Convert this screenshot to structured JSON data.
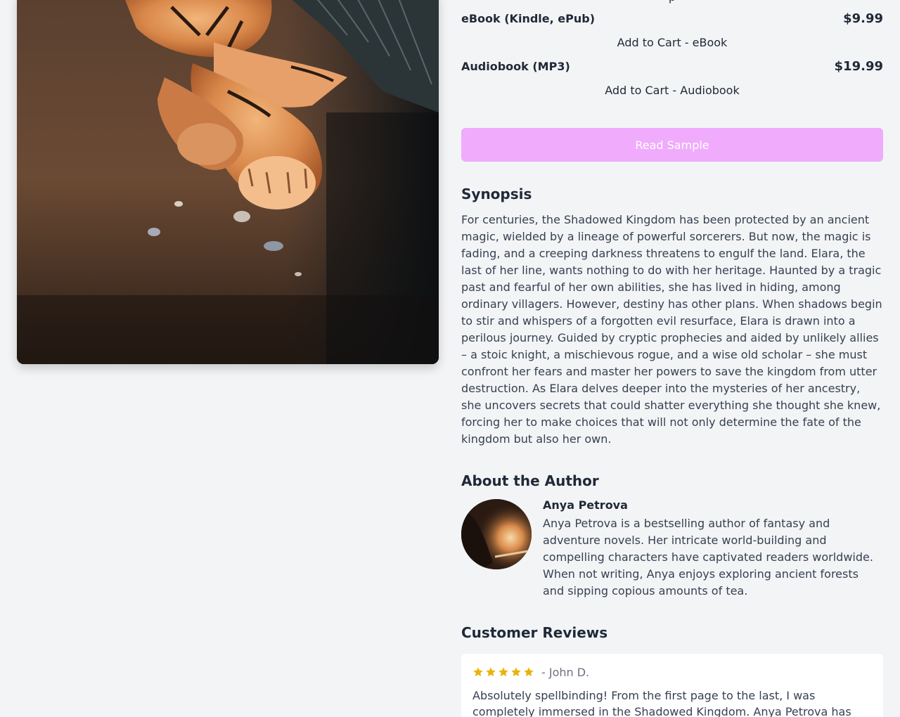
{
  "formats": [
    {
      "name": "eBook (Kindle, ePub)",
      "price": "$9.99",
      "cart_label": "Add to Cart - eBook"
    },
    {
      "name": "Audiobook (MP3)",
      "price": "$19.99",
      "cart_label": "Add to Cart - Audiobook"
    }
  ],
  "read_sample_label": "Read Sample",
  "synopsis": {
    "heading": "Synopsis",
    "text": "For centuries, the Shadowed Kingdom has been protected by an ancient magic, wielded by a lineage of powerful sorcerers. But now, the magic is fading, and a creeping darkness threatens to engulf the land. Elara, the last of her line, wants nothing to do with her heritage. Haunted by a tragic past and fearful of her own abilities, she has lived in hiding, among ordinary villagers. However, destiny has other plans. When shadows begin to stir and whispers of a forgotten evil resurface, Elara is drawn into a perilous journey. Guided by cryptic prophecies and aided by unlikely allies – a stoic knight, a mischievous rogue, and a wise old scholar – she must confront her fears and master her powers to save the kingdom from utter destruction. As Elara delves deeper into the mysteries of her ancestry, she uncovers secrets that could shatter everything she thought she knew, forcing her to make choices that will not only determine the fate of the kingdom but also her own."
  },
  "author": {
    "heading": "About the Author",
    "name": "Anya Petrova",
    "bio": "Anya Petrova is a bestselling author of fantasy and adventure novels. Her intricate world-building and compelling characters have captivated readers worldwide. When not writing, Anya enjoys exploring ancient forests and sipping copious amounts of tea."
  },
  "reviews": {
    "heading": "Customer Reviews",
    "items": [
      {
        "rating": 5,
        "reviewer": "- John D.",
        "text": "Absolutely spellbinding! From the first page to the last, I was completely immersed in the Shadowed Kingdom. Anya Petrova has"
      }
    ]
  },
  "colors": {
    "background": "#f3f4f6",
    "sample_button": "#f0abfc",
    "star": "#eab308",
    "heading": "#1f2937"
  }
}
